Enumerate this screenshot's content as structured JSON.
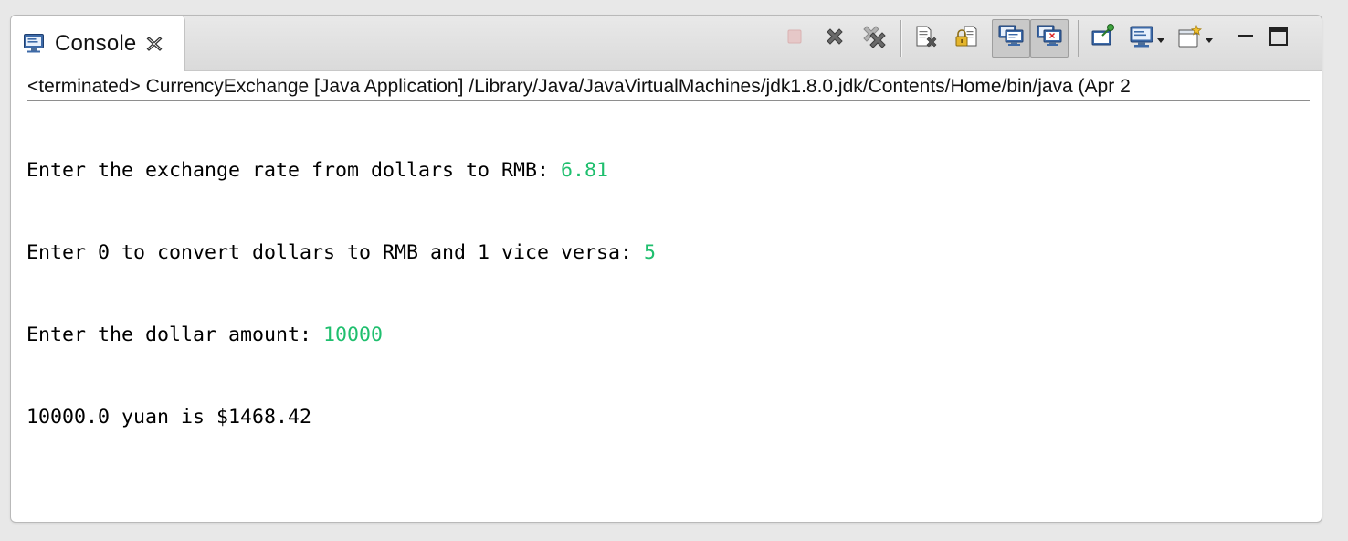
{
  "tab": {
    "label": "Console",
    "icon": "console-monitor-icon",
    "close_icon": "close-x-icon"
  },
  "toolbar": {
    "buttons": [
      {
        "name": "terminate",
        "icon": "red-square-stop-icon",
        "enabled": false
      },
      {
        "name": "remove-launch",
        "icon": "x-icon"
      },
      {
        "name": "remove-all-terminated",
        "icon": "double-x-icon"
      },
      {
        "name": "clear-console",
        "icon": "clear-document-icon"
      },
      {
        "name": "scroll-lock",
        "icon": "lock-document-icon"
      },
      {
        "name": "show-on-stdout",
        "icon": "console-stdout-icon",
        "pressed": true
      },
      {
        "name": "show-on-stderr",
        "icon": "console-stderr-icon",
        "pressed": true
      },
      {
        "name": "pin-console",
        "icon": "pin-icon"
      },
      {
        "name": "display-selected-console",
        "icon": "monitor-icon",
        "dropdown": true
      },
      {
        "name": "open-console",
        "icon": "new-console-icon",
        "dropdown": true
      }
    ],
    "window_controls": [
      "minimize-icon",
      "maximize-icon"
    ]
  },
  "status_line": "<terminated> CurrencyExchange [Java Application] /Library/Java/JavaVirtualMachines/jdk1.8.0.jdk/Contents/Home/bin/java (Apr 2",
  "console": {
    "lines": [
      {
        "prompt": "Enter the exchange rate from dollars to RMB: ",
        "input": "6.81"
      },
      {
        "prompt": "Enter 0 to convert dollars to RMB and 1 vice versa: ",
        "input": "5"
      },
      {
        "prompt": "Enter the dollar amount: ",
        "input": "10000"
      },
      {
        "prompt": "10000.0 yuan is $1468.42",
        "input": ""
      }
    ],
    "input_color": "#1fbf6e",
    "output_color": "#000000"
  }
}
